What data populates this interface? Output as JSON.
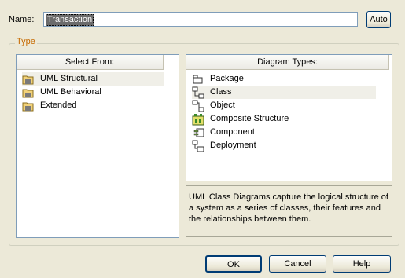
{
  "name_field": {
    "label": "Name:",
    "value": "Transaction",
    "auto_label": "Auto"
  },
  "type_group": {
    "legend": "Type"
  },
  "select_from": {
    "header": "Select From:",
    "items": [
      {
        "label": "UML Structural",
        "icon": "folder-icon",
        "selected": true
      },
      {
        "label": "UML Behavioral",
        "icon": "folder-icon",
        "selected": false
      },
      {
        "label": "Extended",
        "icon": "folder-icon",
        "selected": false
      }
    ]
  },
  "diagram_types": {
    "header": "Diagram Types:",
    "items": [
      {
        "label": "Package",
        "icon": "package-icon",
        "selected": false
      },
      {
        "label": "Class",
        "icon": "class-icon",
        "selected": true
      },
      {
        "label": "Object",
        "icon": "object-icon",
        "selected": false
      },
      {
        "label": "Composite Structure",
        "icon": "composite-structure-icon",
        "selected": false
      },
      {
        "label": "Component",
        "icon": "component-icon",
        "selected": false
      },
      {
        "label": "Deployment",
        "icon": "deployment-icon",
        "selected": false
      }
    ]
  },
  "description": "UML Class Diagrams capture the logical structure of a system as a series of classes, their features and the relationships between them.",
  "buttons": {
    "ok": "OK",
    "cancel": "Cancel",
    "help": "Help"
  },
  "colors": {
    "dialog_bg": "#ece9d8",
    "legend": "#c66a00",
    "button_border": "#003c74"
  }
}
